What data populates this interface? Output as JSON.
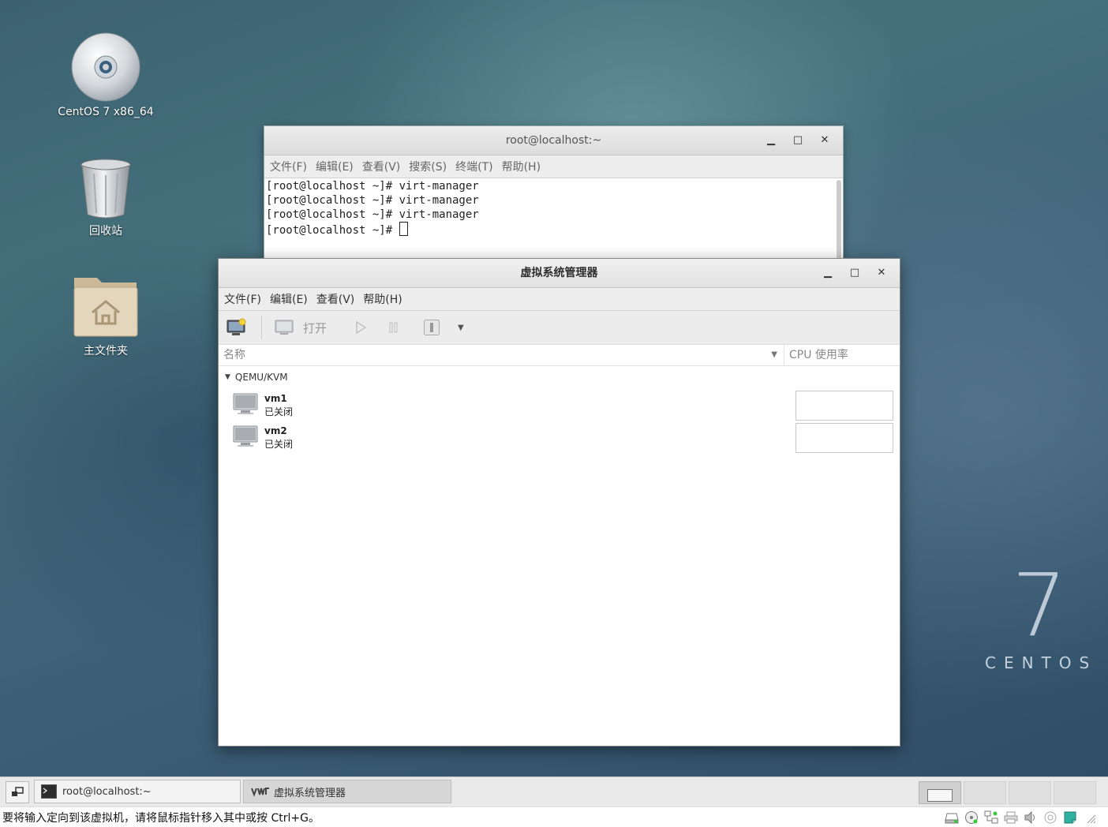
{
  "desktop": {
    "icons": [
      {
        "label": "CentOS 7 x86_64"
      },
      {
        "label": "回收站"
      },
      {
        "label": "主文件夹"
      }
    ],
    "brand_number": "7",
    "brand_text": "CENTOS"
  },
  "terminal": {
    "title": "root@localhost:~",
    "menu": [
      "文件(F)",
      "编辑(E)",
      "查看(V)",
      "搜索(S)",
      "终端(T)",
      "帮助(H)"
    ],
    "lines": [
      "[root@localhost ~]# virt-manager",
      "[root@localhost ~]# virt-manager",
      "[root@localhost ~]# virt-manager"
    ],
    "prompt": "[root@localhost ~]# "
  },
  "vmm": {
    "title": "虚拟系统管理器",
    "menu": [
      "文件(F)",
      "编辑(E)",
      "查看(V)",
      "帮助(H)"
    ],
    "toolbar": {
      "open_label": "打开"
    },
    "columns": {
      "name": "名称",
      "cpu": "CPU 使用率"
    },
    "connection": "QEMU/KVM",
    "vms": [
      {
        "name": "vm1",
        "state": "已关闭"
      },
      {
        "name": "vm2",
        "state": "已关闭"
      }
    ]
  },
  "taskbar": {
    "tasks": [
      {
        "label": "root@localhost:~"
      },
      {
        "label": "虚拟系统管理器"
      }
    ]
  },
  "statusbar": {
    "message": "要将输入定向到该虚拟机，请将鼠标指针移入其中或按 Ctrl+G。"
  }
}
